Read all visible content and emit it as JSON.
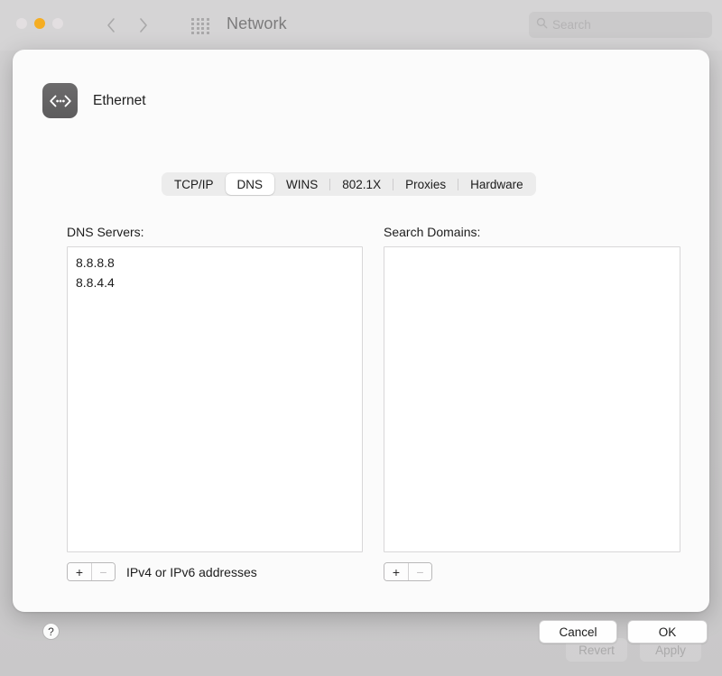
{
  "window": {
    "title": "Network",
    "traffic_lights": [
      {
        "name": "close",
        "color": "#e3dfe1",
        "enabled": false
      },
      {
        "name": "minimize",
        "color": "#f5ad22",
        "enabled": true
      },
      {
        "name": "zoom",
        "color": "#e3dfe1",
        "enabled": false
      }
    ]
  },
  "toolbar": {
    "back_icon": "chevron-left-icon",
    "forward_icon": "chevron-right-icon",
    "grid_icon": "app-grid-icon",
    "search": {
      "icon": "search-icon",
      "value": "",
      "placeholder": "Search"
    }
  },
  "sheet": {
    "service_name": "Ethernet",
    "service_icon": "ethernet-icon",
    "tabs": [
      {
        "label": "TCP/IP",
        "selected": false,
        "separator_before": false
      },
      {
        "label": "DNS",
        "selected": true,
        "separator_before": false
      },
      {
        "label": "WINS",
        "selected": false,
        "separator_before": false
      },
      {
        "label": "802.1X",
        "selected": false,
        "separator_before": true
      },
      {
        "label": "Proxies",
        "selected": false,
        "separator_before": true
      },
      {
        "label": "Hardware",
        "selected": false,
        "separator_before": true
      }
    ],
    "dns_servers": {
      "label": "DNS Servers:",
      "items": [
        "8.8.8.8",
        "8.8.4.4"
      ],
      "hint": "IPv4 or IPv6 addresses",
      "add_label": "+",
      "remove_label": "−",
      "add_enabled": true,
      "remove_enabled": false
    },
    "search_domains": {
      "label": "Search Domains:",
      "items": [],
      "add_label": "+",
      "remove_label": "−",
      "add_enabled": true,
      "remove_enabled": false
    },
    "footer": {
      "help_label": "?",
      "cancel_label": "Cancel",
      "ok_label": "OK"
    }
  },
  "background_controls": {
    "revert_label": "Revert",
    "apply_label": "Apply",
    "enabled": false
  },
  "colors": {
    "window_bg": "#d0cfd0",
    "sheet_bg": "#fbfbfb",
    "accent_yellow": "#f5ad22",
    "text_primary": "#1c1c1c",
    "text_muted": "#7c7b7c",
    "selected_tab_bg": "#ffffff",
    "tabbar_bg": "#ececec"
  }
}
